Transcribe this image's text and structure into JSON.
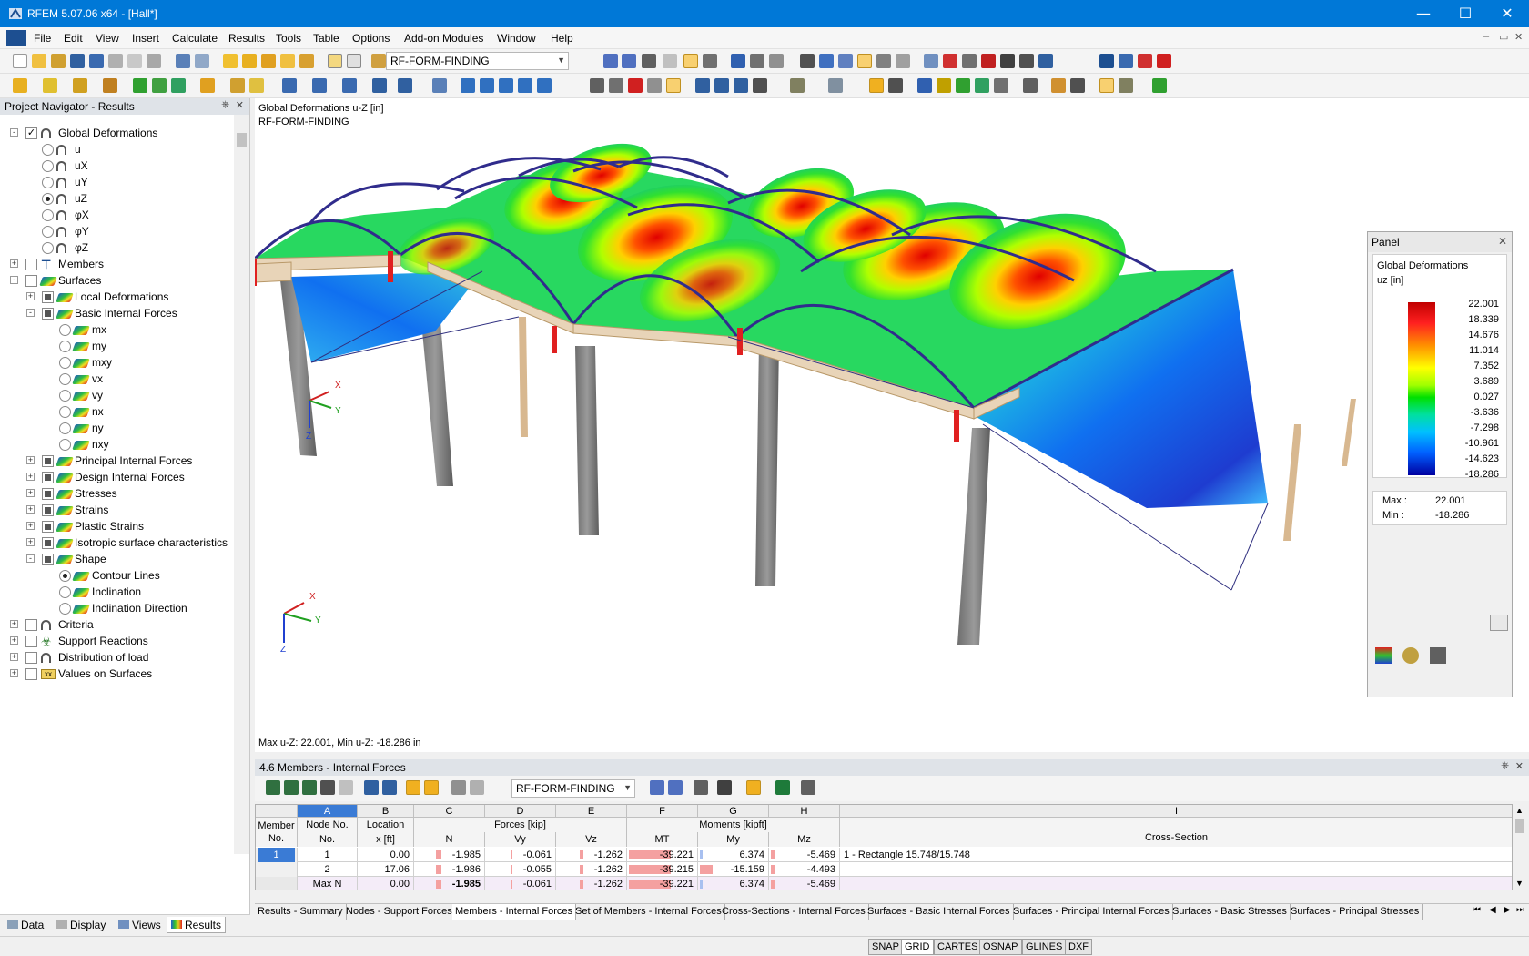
{
  "window": {
    "title": "RFEM 5.07.06 x64 - [Hall*]"
  },
  "menu": [
    "File",
    "Edit",
    "View",
    "Insert",
    "Calculate",
    "Results",
    "Tools",
    "Table",
    "Options",
    "Add-on Modules",
    "Window",
    "Help"
  ],
  "toolbar": {
    "load_case": "RF-FORM-FINDING"
  },
  "navigator": {
    "title": "Project Navigator - Results",
    "items": [
      {
        "label": "Global Deformations",
        "level": 0
      },
      {
        "label": "u",
        "level": 1
      },
      {
        "label": "uX",
        "level": 1
      },
      {
        "label": "uY",
        "level": 1
      },
      {
        "label": "uZ",
        "level": 1,
        "selected": true
      },
      {
        "label": "φX",
        "level": 1
      },
      {
        "label": "φY",
        "level": 1
      },
      {
        "label": "φZ",
        "level": 1
      },
      {
        "label": "Members",
        "level": 0
      },
      {
        "label": "Surfaces",
        "level": 0
      },
      {
        "label": "Local Deformations",
        "level": 1
      },
      {
        "label": "Basic Internal Forces",
        "level": 1
      },
      {
        "label": "mx",
        "level": 2
      },
      {
        "label": "my",
        "level": 2
      },
      {
        "label": "mxy",
        "level": 2
      },
      {
        "label": "vx",
        "level": 2
      },
      {
        "label": "vy",
        "level": 2
      },
      {
        "label": "nx",
        "level": 2
      },
      {
        "label": "ny",
        "level": 2
      },
      {
        "label": "nxy",
        "level": 2
      },
      {
        "label": "Principal Internal Forces",
        "level": 1
      },
      {
        "label": "Design Internal Forces",
        "level": 1
      },
      {
        "label": "Stresses",
        "level": 1
      },
      {
        "label": "Strains",
        "level": 1
      },
      {
        "label": "Plastic Strains",
        "level": 1
      },
      {
        "label": "Isotropic surface characteristics",
        "level": 1
      },
      {
        "label": "Shape",
        "level": 1
      },
      {
        "label": "Contour Lines",
        "level": 2,
        "selected": true
      },
      {
        "label": "Inclination",
        "level": 2
      },
      {
        "label": "Inclination Direction",
        "level": 2
      },
      {
        "label": "Criteria",
        "level": 0
      },
      {
        "label": "Support Reactions",
        "level": 0
      },
      {
        "label": "Distribution of load",
        "level": 0
      },
      {
        "label": "Values on Surfaces",
        "level": 0
      }
    ],
    "tabs": [
      "Data",
      "Display",
      "Views",
      "Results"
    ]
  },
  "view": {
    "title_line1": "Global Deformations u-Z [in]",
    "title_line2": "RF-FORM-FINDING",
    "bottom_text": "Max u-Z: 22.001, Min u-Z: -18.286 in",
    "axes": {
      "x": "X",
      "y": "Y",
      "z": "Z"
    }
  },
  "panel": {
    "title": "Panel",
    "line1": "Global Deformations",
    "line2": "uz [in]",
    "scale": [
      "22.001",
      "18.339",
      "14.676",
      "11.014",
      "7.352",
      "3.689",
      "0.027",
      "-3.636",
      "-7.298",
      "-10.961",
      "-14.623",
      "-18.286"
    ],
    "max_label": "Max  :",
    "max_value": "22.001",
    "min_label": "Min  :",
    "min_value": "-18.286"
  },
  "table": {
    "title": "4.6 Members - Internal Forces",
    "load_case": "RF-FORM-FINDING",
    "col_letters": [
      "A",
      "B",
      "C",
      "D",
      "E",
      "F",
      "G",
      "H",
      "I"
    ],
    "headers": {
      "member_no": "Member No.",
      "node_no": "Node No.",
      "location": "Location",
      "location_unit": "x [ft]",
      "forces": "Forces [kip]",
      "n": "N",
      "vy": "Vy",
      "vz": "Vz",
      "moments": "Moments [kipft]",
      "mt": "MT",
      "my": "My",
      "mz": "Mz",
      "cross_section": "Cross-Section"
    },
    "rows": [
      {
        "member": "1",
        "node": "1",
        "x": "0.00",
        "n": "-1.985",
        "vy": "-0.061",
        "vz": "-1.262",
        "mt": "-39.221",
        "my": "6.374",
        "mz": "-5.469",
        "cs": "1 - Rectangle 15.748/15.748"
      },
      {
        "member": "",
        "node": "2",
        "x": "17.06",
        "n": "-1.986",
        "vy": "-0.055",
        "vz": "-1.262",
        "mt": "-39.215",
        "my": "-15.159",
        "mz": "-4.493",
        "cs": ""
      },
      {
        "member": "",
        "node": "Max N",
        "x": "0.00",
        "n": "-1.985",
        "vy": "-0.061",
        "vz": "-1.262",
        "mt": "-39.221",
        "my": "6.374",
        "mz": "-5.469",
        "cs": ""
      }
    ],
    "tabs": [
      "Results - Summary",
      "Nodes - Support Forces",
      "Members - Internal Forces",
      "Set of Members - Internal Forces",
      "Cross-Sections - Internal Forces",
      "Surfaces - Basic Internal Forces",
      "Surfaces - Principal Internal Forces",
      "Surfaces - Basic Stresses",
      "Surfaces - Principal Stresses"
    ]
  },
  "status": [
    "SNAP",
    "GRID",
    "CARTES",
    "OSNAP",
    "GLINES",
    "DXF"
  ]
}
